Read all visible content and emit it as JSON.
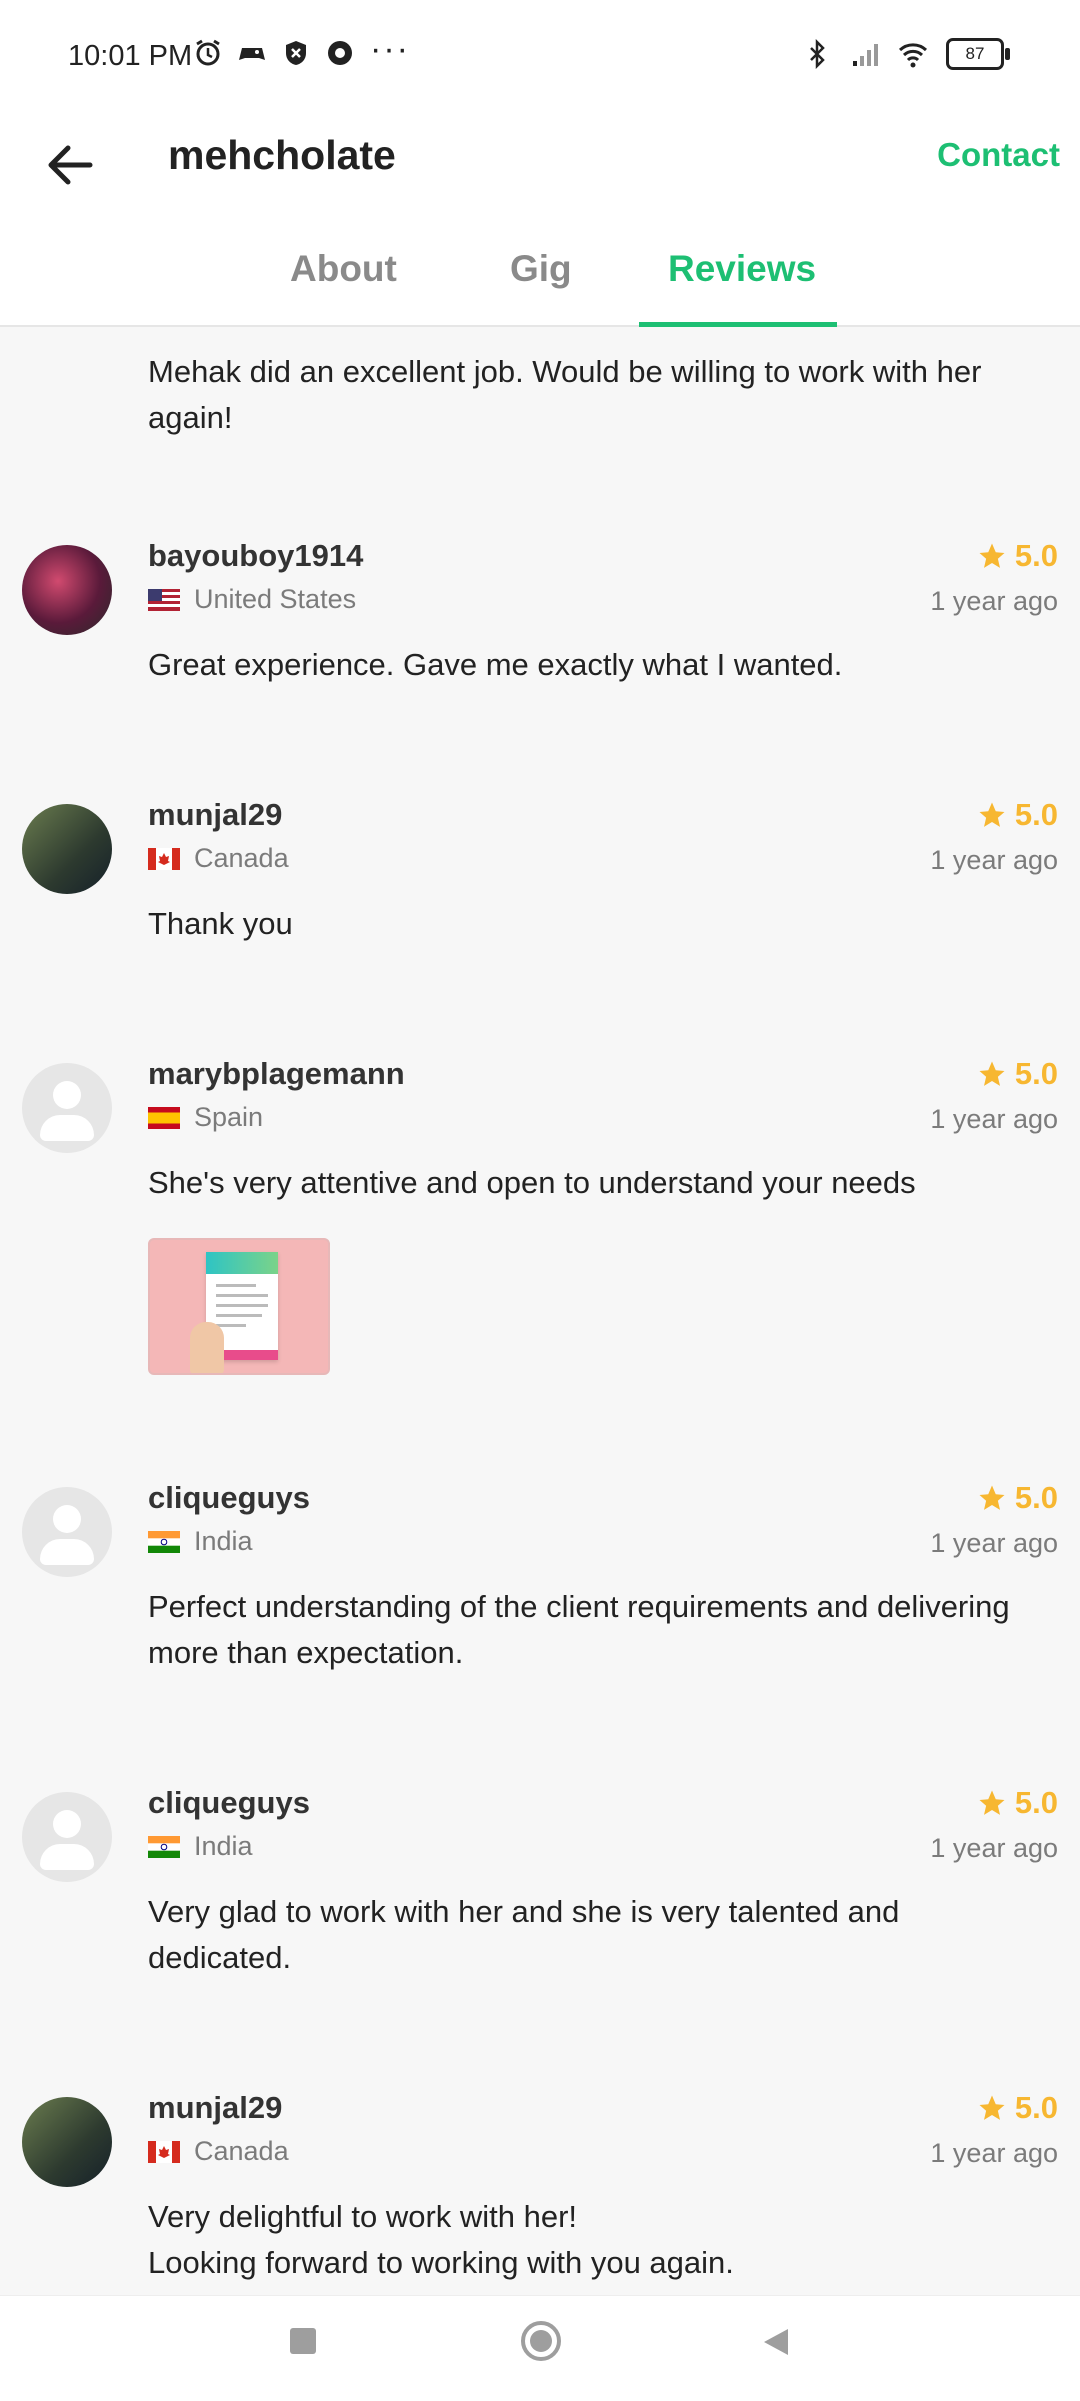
{
  "status_bar": {
    "time": "10:01 PM",
    "more": "···",
    "battery": "87",
    "icons": [
      "alarm-icon",
      "game-icon",
      "shield-icon",
      "media-icon",
      "bluetooth-icon",
      "signal-icon",
      "wifi-icon",
      "battery-icon"
    ]
  },
  "header": {
    "back_icon": "arrow-left-icon",
    "username": "mehcholate",
    "contact_label": "Contact"
  },
  "tabs": [
    {
      "label": "About"
    },
    {
      "label": "Gig"
    },
    {
      "label": "Reviews",
      "active": true
    }
  ],
  "partial_review": {
    "text": "Mehak did an excellent job. Would be willing to work with her again!"
  },
  "reviews": [
    {
      "name": "bayouboy1914",
      "country": "United States",
      "flag": "us",
      "rating": "5.0",
      "time": "1 year ago",
      "text": "Great experience. Gave me exactly what I wanted.",
      "avatar": "photo"
    },
    {
      "name": "munjal29",
      "country": "Canada",
      "flag": "ca",
      "rating": "5.0",
      "time": "1 year ago",
      "text": "Thank you",
      "avatar": "photo"
    },
    {
      "name": "marybplagemann",
      "country": "Spain",
      "flag": "es",
      "rating": "5.0",
      "time": "1 year ago",
      "text": "She's very attentive and open to understand your needs",
      "avatar": "placeholder",
      "has_attachment": true
    },
    {
      "name": "cliqueguys",
      "country": "India",
      "flag": "in",
      "rating": "5.0",
      "time": "1 year ago",
      "text": "Perfect understanding of the client requirements and delivering more than expectation.",
      "avatar": "placeholder"
    },
    {
      "name": "cliqueguys",
      "country": "India",
      "flag": "in",
      "rating": "5.0",
      "time": "1 year ago",
      "text": "Very glad to work with her and she is very talented and dedicated.",
      "avatar": "placeholder"
    },
    {
      "name": "munjal29",
      "country": "Canada",
      "flag": "ca",
      "rating": "5.0",
      "time": "1 year ago",
      "text": "Very delightful to work with her!\nLooking forward to working with you again.",
      "avatar": "photo"
    }
  ],
  "colors": {
    "accent": "#1dbf73",
    "star": "#f7b731",
    "background": "#f7f7f7"
  },
  "nav_bar": {
    "icons": [
      "recent-apps-icon",
      "home-icon",
      "back-triangle-icon"
    ]
  }
}
